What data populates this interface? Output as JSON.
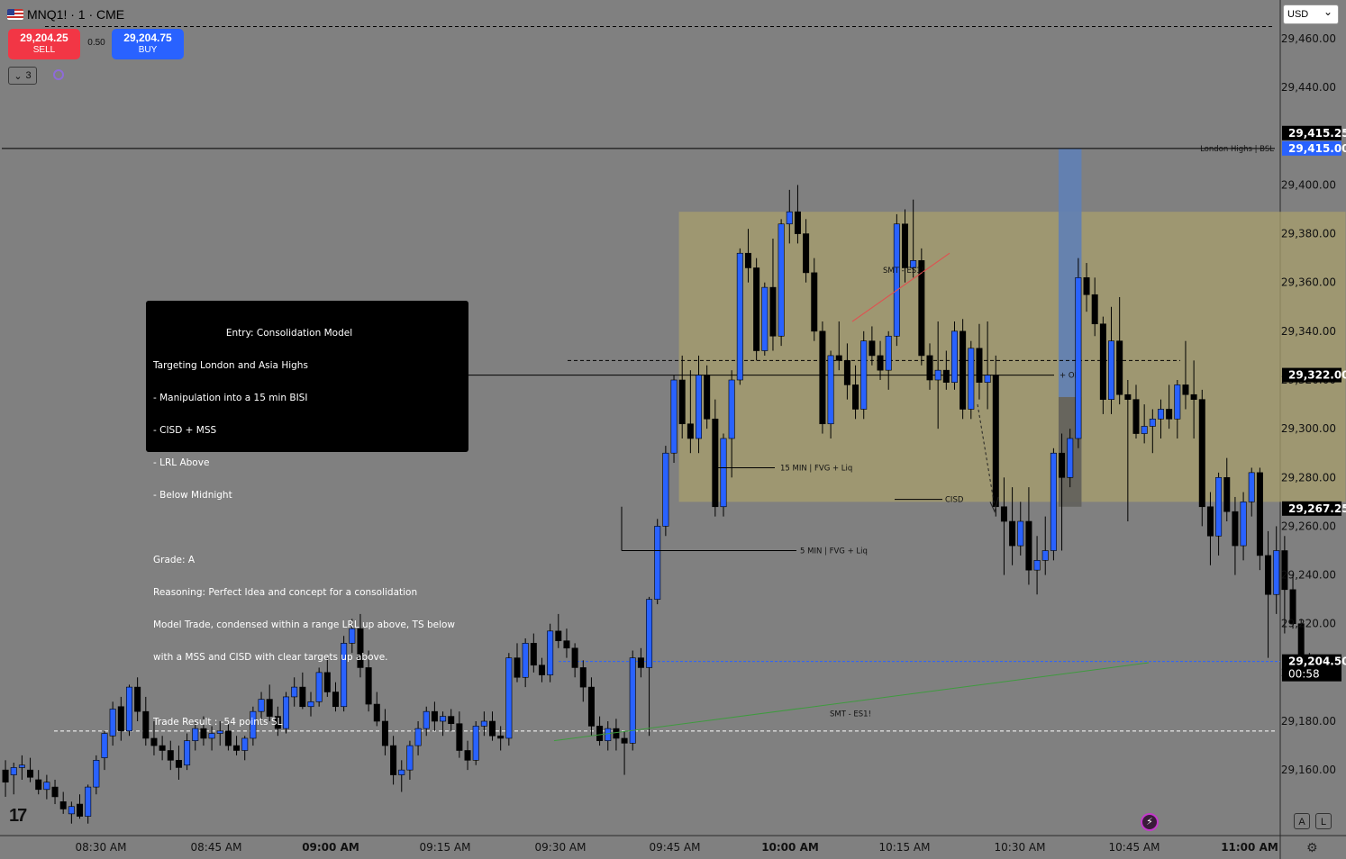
{
  "header": {
    "symbol": "MNQ1! · 1 · CME",
    "sell_price": "29,204.25",
    "sell_label": "SELL",
    "buy_price": "29,204.75",
    "buy_label": "BUY",
    "spread": "0.50",
    "indicators_count": "3"
  },
  "currency": "USD",
  "note": {
    "title": "Entry: Consolidation Model",
    "lines": [
      "Targeting London and Asia Highs",
      "- Manipulation into a 15 min BISI",
      "- CISD + MSS",
      "- LRL Above",
      "- Below Midnight",
      "",
      "Grade: A",
      "Reasoning: Perfect Idea and concept for a consolidation",
      "Model Trade, condensed within a range LRL up above, TS below",
      "with a MSS and CISD with clear targets up above.",
      "",
      "Trade Result : -54 points SL"
    ]
  },
  "price_tags": {
    "upper": "29,415.25",
    "london_high": "29,415.00",
    "ob_level": "29,322.00",
    "cisd_level": "29,267.25",
    "last": "29,204.50",
    "countdown": "00:58"
  },
  "corner_buttons": {
    "auto": "A",
    "log": "L"
  },
  "chart_data": {
    "type": "candlestick",
    "ylim": [
      29150,
      29470
    ],
    "y_ticks": [
      29160,
      29180,
      29200,
      29220,
      29240,
      29260,
      29280,
      29300,
      29320,
      29340,
      29360,
      29380,
      29400,
      29420,
      29440,
      29460
    ],
    "y_tick_labels": [
      "29,160.00",
      "29,180.00",
      "29,200.00",
      "29,220.00",
      "29,240.00",
      "29,260.00",
      "29,280.00",
      "29,300.00",
      "29,320.00",
      "29,340.00",
      "29,360.00",
      "29,380.00",
      "29,400.00",
      "29,420.00",
      "29,440.00",
      "29,460.00"
    ],
    "x_labels": [
      "08:30 AM",
      "08:45 AM",
      "09:00 AM",
      "09:15 AM",
      "09:30 AM",
      "09:45 AM",
      "10:00 AM",
      "10:15 AM",
      "10:30 AM",
      "10:45 AM",
      "11:00 AM"
    ],
    "bold_x_labels": [
      "09:00 AM",
      "10:00 AM",
      "11:00 AM"
    ],
    "x_start": "08:21 AM",
    "bar_minutes": 1,
    "bull_color": "#2962ff",
    "bear_color": "#000000",
    "candles": [
      [
        29160,
        29164,
        29149,
        29155
      ],
      [
        29158,
        29163,
        29150,
        29161
      ],
      [
        29161,
        29166,
        29156,
        29162
      ],
      [
        29160,
        29165,
        29155,
        29157
      ],
      [
        29156,
        29160,
        29150,
        29152
      ],
      [
        29152,
        29158,
        29148,
        29155
      ],
      [
        29153,
        29156,
        29146,
        29149
      ],
      [
        29147,
        29151,
        29142,
        29144
      ],
      [
        29142,
        29147,
        29138,
        29145
      ],
      [
        29146,
        29150,
        29140,
        29141
      ],
      [
        29141,
        29154,
        29138,
        29153
      ],
      [
        29153,
        29166,
        29150,
        29164
      ],
      [
        29165,
        29176,
        29160,
        29175
      ],
      [
        29174,
        29188,
        29170,
        29185
      ],
      [
        29186,
        29190,
        29172,
        29176
      ],
      [
        29176,
        29195,
        29174,
        29194
      ],
      [
        29194,
        29198,
        29180,
        29184
      ],
      [
        29184,
        29190,
        29170,
        29173
      ],
      [
        29173,
        29180,
        29166,
        29170
      ],
      [
        29170,
        29174,
        29164,
        29168
      ],
      [
        29168,
        29172,
        29160,
        29164
      ],
      [
        29164,
        29170,
        29156,
        29161
      ],
      [
        29162,
        29175,
        29160,
        29172
      ],
      [
        29172,
        29180,
        29168,
        29177
      ],
      [
        29177,
        29182,
        29170,
        29173
      ],
      [
        29173,
        29178,
        29168,
        29175
      ],
      [
        29175,
        29180,
        29170,
        29176
      ],
      [
        29176,
        29180,
        29168,
        29170
      ],
      [
        29170,
        29174,
        29166,
        29168
      ],
      [
        29168,
        29174,
        29164,
        29173
      ],
      [
        29173,
        29186,
        29170,
        29184
      ],
      [
        29184,
        29192,
        29180,
        29189
      ],
      [
        29189,
        29195,
        29180,
        29182
      ],
      [
        29182,
        29186,
        29174,
        29177
      ],
      [
        29177,
        29192,
        29175,
        29190
      ],
      [
        29190,
        29198,
        29186,
        29194
      ],
      [
        29194,
        29200,
        29185,
        29186
      ],
      [
        29186,
        29192,
        29182,
        29188
      ],
      [
        29188,
        29202,
        29186,
        29200
      ],
      [
        29200,
        29206,
        29190,
        29192
      ],
      [
        29192,
        29196,
        29184,
        29186
      ],
      [
        29186,
        29215,
        29184,
        29212
      ],
      [
        29212,
        29222,
        29208,
        29218
      ],
      [
        29218,
        29224,
        29198,
        29202
      ],
      [
        29202,
        29209,
        29184,
        29187
      ],
      [
        29187,
        29192,
        29178,
        29180
      ],
      [
        29180,
        29185,
        29166,
        29170
      ],
      [
        29170,
        29174,
        29154,
        29158
      ],
      [
        29158,
        29164,
        29151,
        29160
      ],
      [
        29160,
        29172,
        29156,
        29170
      ],
      [
        29170,
        29180,
        29166,
        29177
      ],
      [
        29177,
        29186,
        29174,
        29184
      ],
      [
        29184,
        29188,
        29176,
        29180
      ],
      [
        29180,
        29184,
        29174,
        29182
      ],
      [
        29182,
        29185,
        29176,
        29179
      ],
      [
        29179,
        29184,
        29165,
        29168
      ],
      [
        29168,
        29172,
        29160,
        29164
      ],
      [
        29164,
        29180,
        29162,
        29178
      ],
      [
        29178,
        29184,
        29174,
        29180
      ],
      [
        29180,
        29184,
        29172,
        29174
      ],
      [
        29174,
        29178,
        29168,
        29173
      ],
      [
        29173,
        29208,
        29170,
        29206
      ],
      [
        29206,
        29212,
        29196,
        29198
      ],
      [
        29198,
        29214,
        29194,
        29212
      ],
      [
        29212,
        29216,
        29200,
        29203
      ],
      [
        29203,
        29206,
        29196,
        29199
      ],
      [
        29199,
        29220,
        29196,
        29217
      ],
      [
        29217,
        29224,
        29210,
        29213
      ],
      [
        29213,
        29218,
        29206,
        29210
      ],
      [
        29210,
        29212,
        29198,
        29202
      ],
      [
        29202,
        29205,
        29188,
        29194
      ],
      [
        29194,
        29198,
        29174,
        29178
      ],
      [
        29178,
        29182,
        29170,
        29172
      ],
      [
        29172,
        29180,
        29168,
        29177
      ],
      [
        29177,
        29181,
        29168,
        29173
      ],
      [
        29173,
        29176,
        29158,
        29171
      ],
      [
        29171,
        29209,
        29168,
        29206
      ],
      [
        29206,
        29210,
        29198,
        29202
      ],
      [
        29202,
        29231,
        29174,
        29230
      ],
      [
        29230,
        29263,
        29228,
        29260
      ],
      [
        29260,
        29293,
        29256,
        29290
      ],
      [
        29290,
        29322,
        29286,
        29320
      ],
      [
        29320,
        29330,
        29296,
        29302
      ],
      [
        29302,
        29324,
        29290,
        29296
      ],
      [
        29296,
        29330,
        29290,
        29322
      ],
      [
        29322,
        29326,
        29300,
        29304
      ],
      [
        29304,
        29312,
        29264,
        29268
      ],
      [
        29268,
        29298,
        29264,
        29296
      ],
      [
        29296,
        29324,
        29280,
        29320
      ],
      [
        29320,
        29374,
        29318,
        29372
      ],
      [
        29372,
        29382,
        29360,
        29366
      ],
      [
        29366,
        29370,
        29328,
        29332
      ],
      [
        29332,
        29360,
        29330,
        29358
      ],
      [
        29358,
        29378,
        29332,
        29338
      ],
      [
        29338,
        29386,
        29334,
        29384
      ],
      [
        29384,
        29398,
        29376,
        29389
      ],
      [
        29389,
        29400,
        29376,
        29380
      ],
      [
        29380,
        29386,
        29360,
        29364
      ],
      [
        29364,
        29370,
        29336,
        29340
      ],
      [
        29340,
        29344,
        29298,
        29302
      ],
      [
        29302,
        29332,
        29296,
        29330
      ],
      [
        29330,
        29344,
        29324,
        29328
      ],
      [
        29328,
        29335,
        29312,
        29318
      ],
      [
        29318,
        29326,
        29304,
        29308
      ],
      [
        29308,
        29340,
        29304,
        29336
      ],
      [
        29336,
        29342,
        29326,
        29330
      ],
      [
        29330,
        29336,
        29320,
        29324
      ],
      [
        29324,
        29340,
        29316,
        29338
      ],
      [
        29338,
        29388,
        29334,
        29384
      ],
      [
        29384,
        29390,
        29360,
        29366
      ],
      [
        29366,
        29394,
        29362,
        29369
      ],
      [
        29369,
        29374,
        29326,
        29330
      ],
      [
        29330,
        29335,
        29316,
        29320
      ],
      [
        29320,
        29344,
        29300,
        29324
      ],
      [
        29324,
        29332,
        29316,
        29319
      ],
      [
        29319,
        29344,
        29316,
        29340
      ],
      [
        29340,
        29345,
        29304,
        29308
      ],
      [
        29308,
        29336,
        29304,
        29333
      ],
      [
        29333,
        29343,
        29312,
        29319
      ],
      [
        29319,
        29344,
        29308,
        29322
      ],
      [
        29322,
        29330,
        29264,
        29268
      ],
      [
        29268,
        29280,
        29240,
        29262
      ],
      [
        29262,
        29276,
        29244,
        29252
      ],
      [
        29252,
        29270,
        29248,
        29262
      ],
      [
        29262,
        29276,
        29236,
        29242
      ],
      [
        29242,
        29256,
        29232,
        29246
      ],
      [
        29246,
        29264,
        29240,
        29250
      ],
      [
        29250,
        29292,
        29246,
        29290
      ],
      [
        29290,
        29298,
        29250,
        29280
      ],
      [
        29280,
        29300,
        29276,
        29296
      ],
      [
        29296,
        29370,
        29292,
        29362
      ],
      [
        29362,
        29368,
        29348,
        29355
      ],
      [
        29355,
        29362,
        29338,
        29343
      ],
      [
        29343,
        29346,
        29306,
        29312
      ],
      [
        29312,
        29350,
        29306,
        29336
      ],
      [
        29336,
        29354,
        29310,
        29314
      ],
      [
        29314,
        29320,
        29262,
        29312
      ],
      [
        29312,
        29318,
        29296,
        29298
      ],
      [
        29298,
        29310,
        29294,
        29301
      ],
      [
        29301,
        29308,
        29290,
        29304
      ],
      [
        29304,
        29312,
        29296,
        29308
      ],
      [
        29308,
        29318,
        29300,
        29304
      ],
      [
        29304,
        29320,
        29296,
        29318
      ],
      [
        29318,
        29336,
        29308,
        29314
      ],
      [
        29314,
        29328,
        29296,
        29312
      ],
      [
        29312,
        29316,
        29260,
        29268
      ],
      [
        29268,
        29274,
        29244,
        29256
      ],
      [
        29256,
        29282,
        29248,
        29280
      ],
      [
        29280,
        29288,
        29262,
        29266
      ],
      [
        29266,
        29272,
        29240,
        29252
      ],
      [
        29252,
        29274,
        29246,
        29270
      ],
      [
        29270,
        29284,
        29264,
        29282
      ],
      [
        29282,
        29284,
        29242,
        29248
      ],
      [
        29248,
        29258,
        29206,
        29232
      ],
      [
        29232,
        29260,
        29224,
        29250
      ],
      [
        29250,
        29256,
        29216,
        29234
      ],
      [
        29234,
        29240,
        29218,
        29220
      ],
      [
        29220,
        29222,
        29204,
        29204
      ],
      [
        29204,
        29208,
        29202,
        29205
      ]
    ],
    "zones": [
      {
        "name": "consolidation-range",
        "x_from_bar": 82,
        "x_to_bar": 162,
        "top": 29389,
        "bottom": 29270,
        "color": "#a89f6c"
      },
      {
        "name": "target-box",
        "x_from_bar": 128,
        "x_to_bar": 130,
        "top": 29415,
        "bottom": 29313,
        "color": "#5f7fb5"
      },
      {
        "name": "stop-box",
        "x_from_bar": 128,
        "x_to_bar": 130,
        "top": 29313,
        "bottom": 29268,
        "color": "#615f5b"
      }
    ],
    "levels": [
      {
        "name": "london-highs",
        "value": 29415,
        "label": "London Highs | BSL",
        "style": "solid",
        "color": "#000000"
      },
      {
        "name": "top-dashed",
        "value": 29465,
        "label": "",
        "style": "dashed",
        "color": "#000000"
      },
      {
        "name": "range-mid",
        "value": 29328,
        "label": "",
        "style": "dashed",
        "color": "#000000"
      },
      {
        "name": "ob-line",
        "value": 29322,
        "label": "+ OB",
        "style": "solid",
        "color": "#000000"
      },
      {
        "name": "lower-dashed",
        "value": 29176,
        "label": "",
        "style": "dashed-white",
        "color": "#ffffff"
      },
      {
        "name": "last-price",
        "value": 29204.5,
        "label": "",
        "style": "dashed",
        "color": "#2962ff"
      }
    ],
    "annotations": [
      {
        "name": "fvg-15m",
        "text": "15 MIN | FVG + Liq",
        "price": 29284
      },
      {
        "name": "fvg-5m",
        "text": "5 MIN | FVG + Liq",
        "price": 29250
      },
      {
        "name": "cisd",
        "text": "CISD",
        "price": 29271
      },
      {
        "name": "smt-upper",
        "text": "SMT - ES1!",
        "price": 29364
      },
      {
        "name": "smt-lower",
        "text": "SMT - ES1!",
        "price": 29182
      }
    ]
  }
}
